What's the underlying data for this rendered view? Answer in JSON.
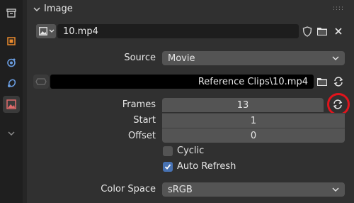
{
  "panel": {
    "title": "Image"
  },
  "datablock": {
    "name": "10.mp4"
  },
  "source": {
    "label": "Source",
    "value": "Movie"
  },
  "filepath": {
    "value": "Reference Clips\\10.mp4"
  },
  "frames": {
    "label": "Frames",
    "value": "13"
  },
  "start": {
    "label": "Start",
    "value": "1"
  },
  "offset": {
    "label": "Offset",
    "value": "0"
  },
  "cyclic": {
    "label": "Cyclic",
    "checked": false
  },
  "auto_refresh": {
    "label": "Auto Refresh",
    "checked": true
  },
  "color_space": {
    "label": "Color Space",
    "value": "sRGB"
  },
  "colors": {
    "accent": "#4772b3",
    "highlight_circle": "#e0141c"
  },
  "icons": [
    "toolbox-icon",
    "object-icon",
    "physics-icon",
    "constraint-icon",
    "image-icon",
    "chevron-down-icon",
    "shield-icon",
    "folder-icon",
    "close-icon",
    "refresh-icon"
  ]
}
